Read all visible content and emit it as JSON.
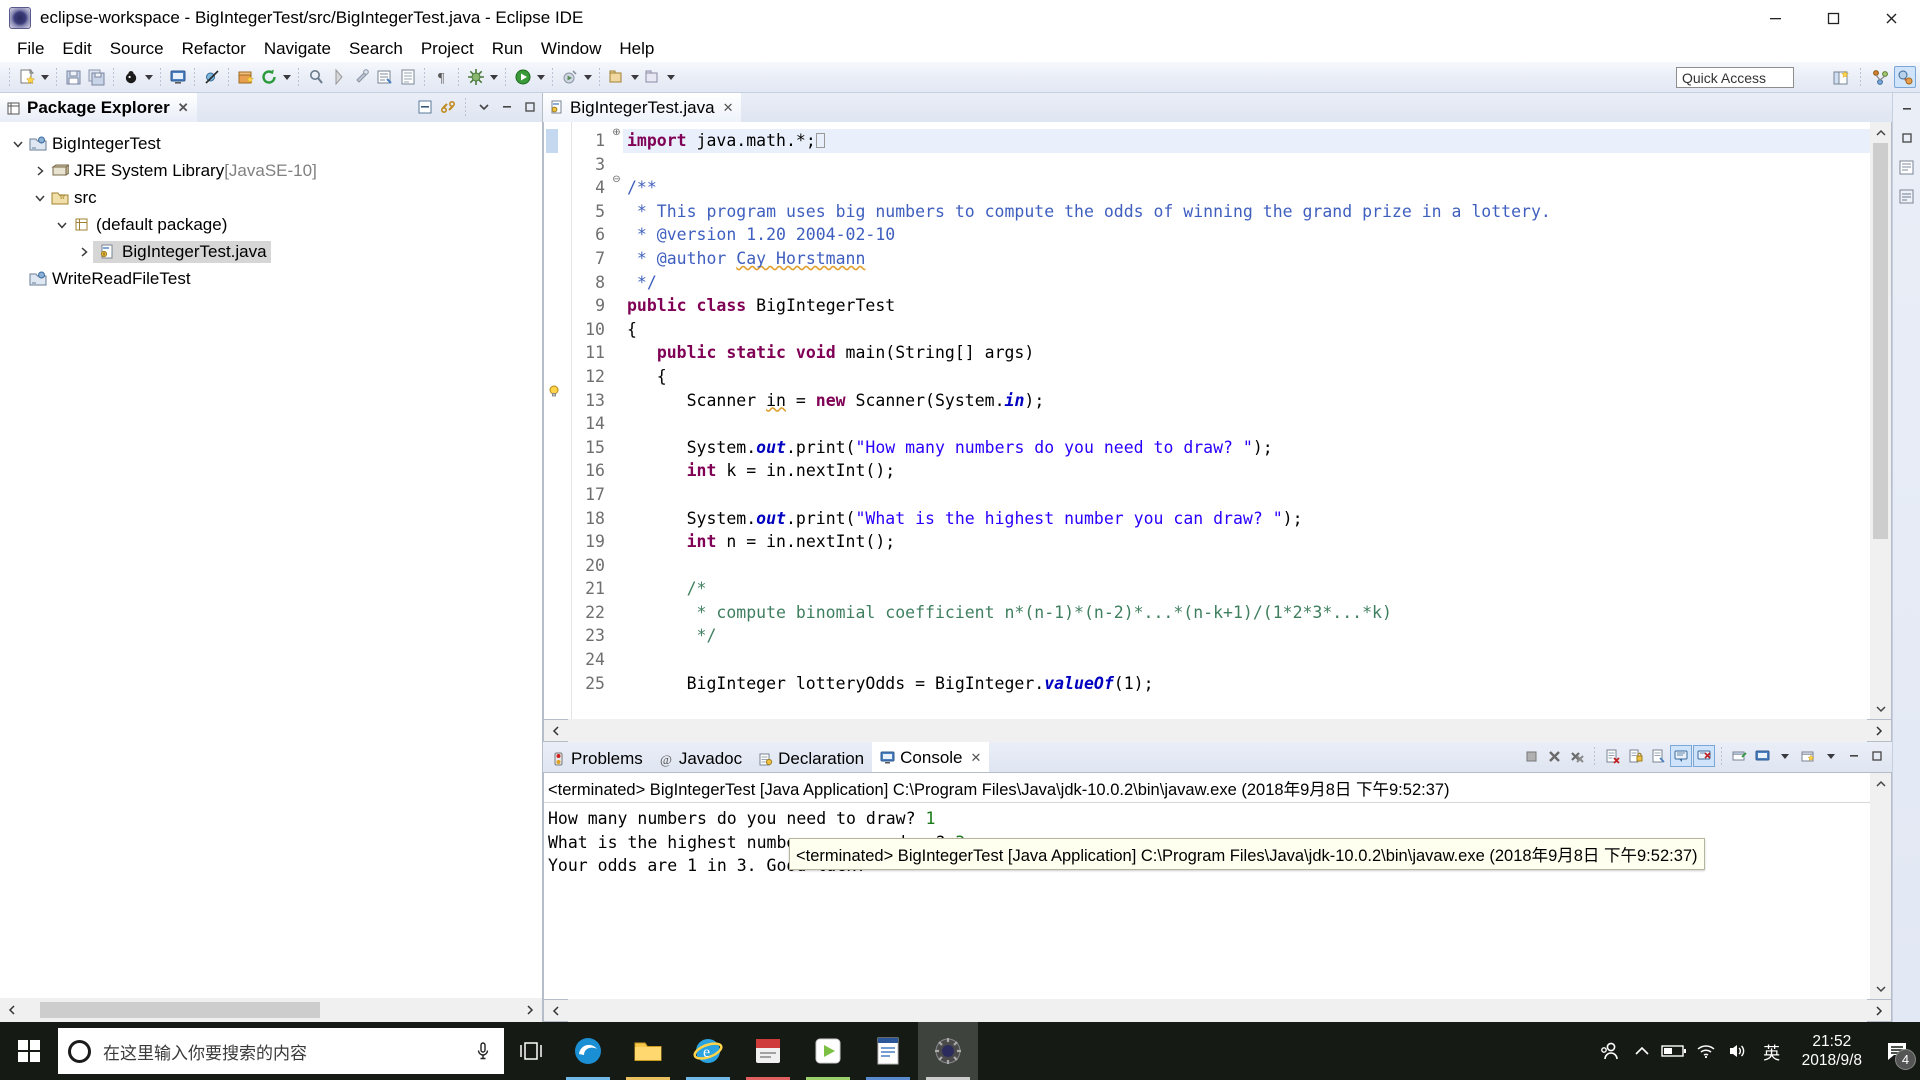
{
  "window": {
    "title": "eclipse-workspace - BigIntegerTest/src/BigIntegerTest.java - Eclipse IDE",
    "minimize_label": "—",
    "maximize_label": "❐",
    "close_label": "✕"
  },
  "menubar": [
    {
      "label": "File"
    },
    {
      "label": "Edit"
    },
    {
      "label": "Source"
    },
    {
      "label": "Refactor"
    },
    {
      "label": "Navigate"
    },
    {
      "label": "Search"
    },
    {
      "label": "Project"
    },
    {
      "label": "Run"
    },
    {
      "label": "Window"
    },
    {
      "label": "Help"
    }
  ],
  "toolbar": {
    "quick_access_placeholder": "Quick Access"
  },
  "package_explorer": {
    "tab_label": "Package Explorer",
    "close_glyph": "✕",
    "tree": [
      {
        "label": "BigIntegerTest",
        "indent": 0,
        "twisty": "open",
        "icon": "java-project-icon",
        "selected": false,
        "dim": false
      },
      {
        "label": "JRE System Library",
        "suffix": " [JavaSE-10]",
        "indent": 1,
        "twisty": "closed",
        "icon": "library-icon",
        "selected": false,
        "dim": false
      },
      {
        "label": "src",
        "indent": 1,
        "twisty": "open",
        "icon": "source-folder-icon",
        "selected": false,
        "dim": false
      },
      {
        "label": "(default package)",
        "indent": 2,
        "twisty": "open",
        "icon": "package-icon",
        "selected": false,
        "dim": false
      },
      {
        "label": "BigIntegerTest.java",
        "indent": 3,
        "twisty": "closed",
        "icon": "java-file-icon",
        "selected": true,
        "dim": false
      },
      {
        "label": "WriteReadFileTest",
        "indent": 0,
        "twisty": "none",
        "icon": "java-project-icon",
        "selected": false,
        "dim": false
      }
    ]
  },
  "editor": {
    "tab_label": "BigIntegerTest.java",
    "close_glyph": "✕",
    "lines": [
      {
        "num": "1",
        "fold": "⊕",
        "highlight": true,
        "caret": true,
        "segments": [
          {
            "t": "import",
            "c": "kw"
          },
          {
            "t": " java.math.*;",
            "c": ""
          }
        ]
      },
      {
        "num": "3",
        "fold": "",
        "highlight": false,
        "segments": []
      },
      {
        "num": "4",
        "fold": "⊖",
        "highlight": false,
        "segments": [
          {
            "t": "/**",
            "c": "jdoc"
          }
        ]
      },
      {
        "num": "5",
        "fold": "",
        "highlight": false,
        "segments": [
          {
            "t": " * This program uses big numbers to compute the odds of winning the grand prize in a lottery.",
            "c": "jdoc"
          }
        ]
      },
      {
        "num": "6",
        "fold": "",
        "highlight": false,
        "segments": [
          {
            "t": " * @version 1.20 2004-02-10",
            "c": "jdoc"
          }
        ]
      },
      {
        "num": "7",
        "fold": "",
        "highlight": false,
        "segments": [
          {
            "t": " * @author ",
            "c": "jdoc"
          },
          {
            "t": "Cay Horstmann",
            "c": "jdoc sq"
          }
        ]
      },
      {
        "num": "8",
        "fold": "",
        "highlight": false,
        "segments": [
          {
            "t": " */",
            "c": "jdoc"
          }
        ]
      },
      {
        "num": "9",
        "fold": "",
        "highlight": false,
        "segments": [
          {
            "t": "public class",
            "c": "kw"
          },
          {
            "t": " BigIntegerTest",
            "c": ""
          }
        ]
      },
      {
        "num": "10",
        "fold": "",
        "highlight": false,
        "segments": [
          {
            "t": "{",
            "c": ""
          }
        ]
      },
      {
        "num": "11",
        "fold": "⊖",
        "highlight": false,
        "segments": [
          {
            "t": "   ",
            "c": ""
          },
          {
            "t": "public static void",
            "c": "kw"
          },
          {
            "t": " main(String[] args)",
            "c": ""
          }
        ]
      },
      {
        "num": "12",
        "fold": "",
        "highlight": false,
        "segments": [
          {
            "t": "   {",
            "c": ""
          }
        ]
      },
      {
        "num": "13",
        "fold": "",
        "highlight": false,
        "bulb": true,
        "segments": [
          {
            "t": "      Scanner ",
            "c": ""
          },
          {
            "t": "in",
            "c": "sq"
          },
          {
            "t": " = ",
            "c": ""
          },
          {
            "t": "new",
            "c": "kw"
          },
          {
            "t": " Scanner(System.",
            "c": ""
          },
          {
            "t": "in",
            "c": "fld"
          },
          {
            "t": ");",
            "c": ""
          }
        ]
      },
      {
        "num": "14",
        "fold": "",
        "highlight": false,
        "segments": []
      },
      {
        "num": "15",
        "fold": "",
        "highlight": false,
        "segments": [
          {
            "t": "      System.",
            "c": ""
          },
          {
            "t": "out",
            "c": "fld"
          },
          {
            "t": ".print(",
            "c": ""
          },
          {
            "t": "\"How many numbers do you need to draw? \"",
            "c": "str"
          },
          {
            "t": ");",
            "c": ""
          }
        ]
      },
      {
        "num": "16",
        "fold": "",
        "highlight": false,
        "segments": [
          {
            "t": "      ",
            "c": ""
          },
          {
            "t": "int",
            "c": "kw"
          },
          {
            "t": " k = in.nextInt();",
            "c": ""
          }
        ]
      },
      {
        "num": "17",
        "fold": "",
        "highlight": false,
        "segments": []
      },
      {
        "num": "18",
        "fold": "",
        "highlight": false,
        "segments": [
          {
            "t": "      System.",
            "c": ""
          },
          {
            "t": "out",
            "c": "fld"
          },
          {
            "t": ".print(",
            "c": ""
          },
          {
            "t": "\"What is the highest number you can draw? \"",
            "c": "str"
          },
          {
            "t": ");",
            "c": ""
          }
        ]
      },
      {
        "num": "19",
        "fold": "",
        "highlight": false,
        "segments": [
          {
            "t": "      ",
            "c": ""
          },
          {
            "t": "int",
            "c": "kw"
          },
          {
            "t": " n = in.nextInt();",
            "c": ""
          }
        ]
      },
      {
        "num": "20",
        "fold": "",
        "highlight": false,
        "segments": []
      },
      {
        "num": "21",
        "fold": "",
        "highlight": false,
        "segments": [
          {
            "t": "      /*",
            "c": "cmt"
          }
        ]
      },
      {
        "num": "22",
        "fold": "",
        "highlight": false,
        "segments": [
          {
            "t": "       * compute binomial coefficient n*(n-1)*(n-2)*...*(n-k+1)/(1*2*3*...*k)",
            "c": "cmt"
          }
        ]
      },
      {
        "num": "23",
        "fold": "",
        "highlight": false,
        "segments": [
          {
            "t": "       */",
            "c": "cmt"
          }
        ]
      },
      {
        "num": "24",
        "fold": "",
        "highlight": false,
        "segments": []
      },
      {
        "num": "25",
        "fold": "",
        "highlight": false,
        "segments": [
          {
            "t": "      BigInteger lotteryOdds = BigInteger.",
            "c": ""
          },
          {
            "t": "valueOf",
            "c": "fld"
          },
          {
            "t": "(1);",
            "c": ""
          }
        ]
      }
    ]
  },
  "console": {
    "tabs": [
      {
        "label": "Problems",
        "icon": "problems-icon",
        "active": false
      },
      {
        "label": "Javadoc",
        "icon": "javadoc-icon",
        "active": false
      },
      {
        "label": "Declaration",
        "icon": "declaration-icon",
        "active": false
      },
      {
        "label": "Console",
        "icon": "console-icon",
        "active": true
      }
    ],
    "close_glyph": "✕",
    "header": "<terminated> BigIntegerTest [Java Application] C:\\Program Files\\Java\\jdk-10.0.2\\bin\\javaw.exe (2018年9月8日 下午9:52:37)",
    "output": [
      {
        "text": "How many numbers do you need to draw? ",
        "input": "1"
      },
      {
        "text": "What is the highest number you can draw? ",
        "input": "3"
      },
      {
        "text": "Your odds are 1 in 3. Good luck!",
        "input": ""
      }
    ],
    "tooltip": "<terminated> BigIntegerTest [Java Application] C:\\Program Files\\Java\\jdk-10.0.2\\bin\\javaw.exe (2018年9月8日 下午9:52:37)"
  },
  "taskbar": {
    "search_placeholder": "在这里输入你要搜索的内容",
    "clock_time": "21:52",
    "clock_date": "2018/9/8",
    "ime_label": "英",
    "notification_count": "4",
    "apps": [
      {
        "name": "edge",
        "color": "#1b8fd4"
      },
      {
        "name": "file-explorer",
        "color": "#f8c84b"
      },
      {
        "name": "internet-explorer",
        "color": "#2aa3e0"
      },
      {
        "name": "app-red",
        "color": "#cf3a3a"
      },
      {
        "name": "media-player",
        "color": "#7bc043"
      },
      {
        "name": "word",
        "color": "#2b579a"
      },
      {
        "name": "eclipse",
        "color": "#4a4a4a"
      }
    ]
  },
  "colors": {
    "accent": "#2a00ff",
    "keyword": "#7f0055",
    "comment": "#3f7f5f",
    "javadoc": "#3f5fbf",
    "selection": "#d6d6d6",
    "taskbar_bg": "#151a14"
  }
}
